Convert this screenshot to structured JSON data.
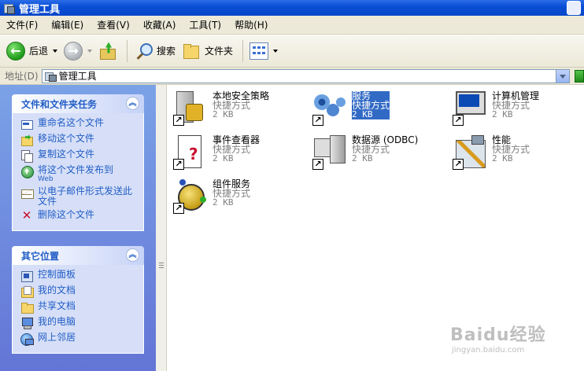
{
  "window": {
    "title": "管理工具"
  },
  "menu": [
    "文件(F)",
    "编辑(E)",
    "查看(V)",
    "收藏(A)",
    "工具(T)",
    "帮助(H)"
  ],
  "toolbar": {
    "back_label": "后退",
    "search_label": "搜索",
    "folders_label": "文件夹"
  },
  "address": {
    "label": "地址(D)",
    "value": "管理工具"
  },
  "file_tasks": {
    "title": "文件和文件夹任务",
    "items": [
      {
        "label": "重命名这个文件",
        "icon": "rename-icon"
      },
      {
        "label": "移动这个文件",
        "icon": "move-icon"
      },
      {
        "label": "复制这个文件",
        "icon": "copy-icon"
      },
      {
        "label": "将这个文件发布到",
        "sub": "Web",
        "icon": "publish-icon"
      },
      {
        "label": "以电子邮件形式发送此文件",
        "icon": "email-icon"
      },
      {
        "label": "删除这个文件",
        "icon": "delete-icon"
      }
    ]
  },
  "other_places": {
    "title": "其它位置",
    "items": [
      {
        "label": "控制面板",
        "icon": "control-panel-icon"
      },
      {
        "label": "我的文档",
        "icon": "my-documents-icon"
      },
      {
        "label": "共享文档",
        "icon": "shared-documents-icon"
      },
      {
        "label": "我的电脑",
        "icon": "my-computer-icon"
      },
      {
        "label": "网上邻居",
        "icon": "network-icon"
      }
    ]
  },
  "files": [
    {
      "name": "本地安全策略",
      "type": "快捷方式",
      "size": "2 KB",
      "icon": "local-security-policy-icon",
      "selected": false
    },
    {
      "name": "服务",
      "type": "快捷方式",
      "size": "2 KB",
      "icon": "services-icon",
      "selected": true
    },
    {
      "name": "计算机管理",
      "type": "快捷方式",
      "size": "2 KB",
      "icon": "computer-management-icon",
      "selected": false
    },
    {
      "name": "事件查看器",
      "type": "快捷方式",
      "size": "2 KB",
      "icon": "event-viewer-icon",
      "selected": false
    },
    {
      "name": "数据源 (ODBC)",
      "type": "快捷方式",
      "size": "2 KB",
      "icon": "odbc-icon",
      "selected": false
    },
    {
      "name": "性能",
      "type": "快捷方式",
      "size": "2 KB",
      "icon": "performance-icon",
      "selected": false
    },
    {
      "name": "组件服务",
      "type": "快捷方式",
      "size": "2 KB",
      "icon": "component-services-icon",
      "selected": false
    }
  ],
  "watermark": {
    "main": "Baidu经验",
    "sub": "jingyan.baidu.com"
  }
}
